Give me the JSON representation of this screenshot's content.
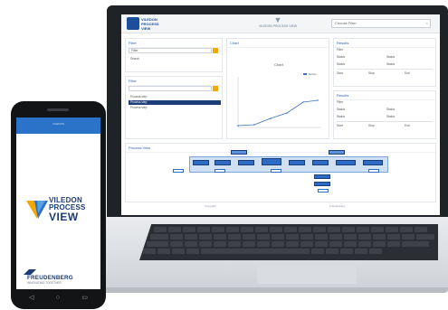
{
  "laptop": {
    "header": {
      "brand_mini": "VILEDON PROCESS VIEW",
      "center_icon": "viledon-v-icon",
      "center_text": "VILEDON PROCESS VIEW",
      "search_value": "Choose Filter",
      "close_glyph": "×"
    },
    "left_panel_top": {
      "title": "Filter",
      "field_value": "Filter",
      "row_label": "Search"
    },
    "left_panel_bottom": {
      "title": "Filter",
      "rows": [
        "Process step",
        "Process step",
        "Process step"
      ]
    },
    "chart_panel": {
      "title": "Chart",
      "subtitle": "Chart",
      "legend": "Series"
    },
    "right_panel_top": {
      "title": "Results",
      "labels": [
        "Filter",
        "Status",
        "Status",
        "Status",
        "Status",
        "Start",
        "Stop",
        "End"
      ]
    },
    "right_panel_bottom": {
      "title": "Results",
      "labels": [
        "Filter",
        "Status",
        "Status",
        "Status",
        "Status",
        "Start",
        "Stop",
        "End"
      ]
    },
    "process_panel": {
      "title": "Process View"
    },
    "footer": {
      "left_text": "Copyright",
      "right_text": "Freudenberg"
    }
  },
  "phone": {
    "topbar_label": "VILEDON",
    "logo_line1": "VILEDON",
    "logo_line2": "PROCESS",
    "logo_line3": "VIEW",
    "company_name": "FREUDENBERG",
    "company_tagline": "INNOVATING TOGETHER",
    "nav_icons": [
      "back-icon",
      "home-icon",
      "recent-apps-icon"
    ],
    "nav_glyphs": [
      "◁",
      "○",
      "▭"
    ]
  },
  "colors": {
    "brand_blue": "#1b3c77",
    "accent_blue": "#2a73c9",
    "accent_orange": "#f2a900",
    "screen_bg": "#ffffff",
    "device_black": "#121416"
  }
}
